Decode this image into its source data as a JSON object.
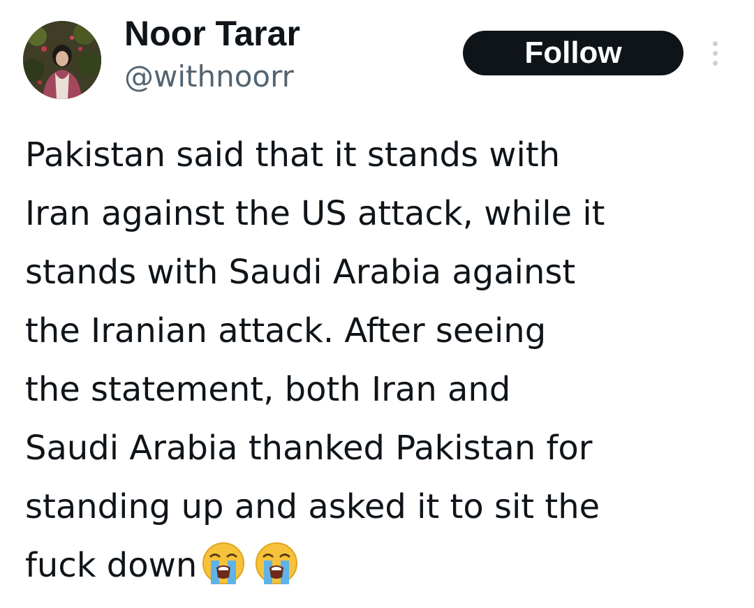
{
  "tweet": {
    "author": {
      "display_name": "Noor Tarar",
      "handle": "@withnoorr",
      "avatar_icon": "profile-photo"
    },
    "follow_label": "Follow",
    "more_icon": "vertical-ellipsis-icon",
    "text_lines": [
      "Pakistan said that it stands with",
      "Iran against the US attack, while it",
      "stands with Saudi Arabia against",
      "the Iranian attack. After seeing",
      "the statement, both Iran and",
      "Saudi Arabia thanked Pakistan for",
      "standing up and asked it to sit the",
      "fuck down"
    ],
    "trailing_emojis": [
      "loudly-crying-face-emoji",
      "loudly-crying-face-emoji"
    ],
    "colors": {
      "text": "#0f1419",
      "secondary_text": "#536471",
      "follow_button_bg": "#0f1419",
      "follow_button_text": "#ffffff",
      "emoji_face": "#f7c23b",
      "emoji_tears": "#5fb3e8"
    }
  }
}
